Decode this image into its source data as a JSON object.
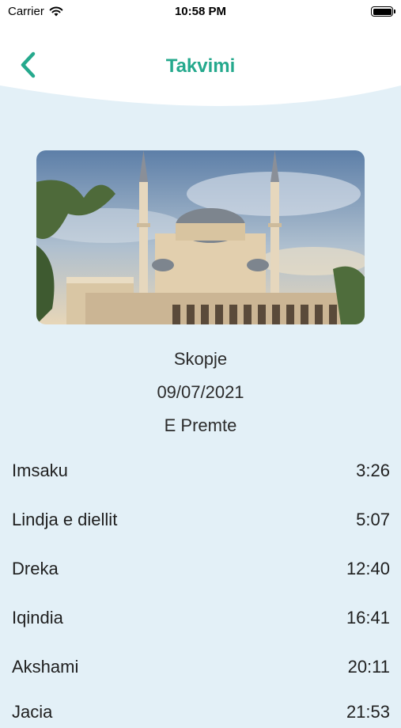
{
  "status_bar": {
    "carrier": "Carrier",
    "time": "10:58 PM"
  },
  "header": {
    "title": "Takvimi",
    "accent_color": "#25a98d"
  },
  "location": {
    "city": "Skopje",
    "date": "09/07/2021",
    "weekday": "E Premte"
  },
  "prayer_times": [
    {
      "name": "Imsaku",
      "time": "3:26"
    },
    {
      "name": "Lindja e diellit",
      "time": "5:07"
    },
    {
      "name": "Dreka",
      "time": "12:40"
    },
    {
      "name": "Iqindia",
      "time": "16:41"
    },
    {
      "name": "Akshami",
      "time": "20:11"
    },
    {
      "name": "Jacia",
      "time": "21:53"
    }
  ]
}
